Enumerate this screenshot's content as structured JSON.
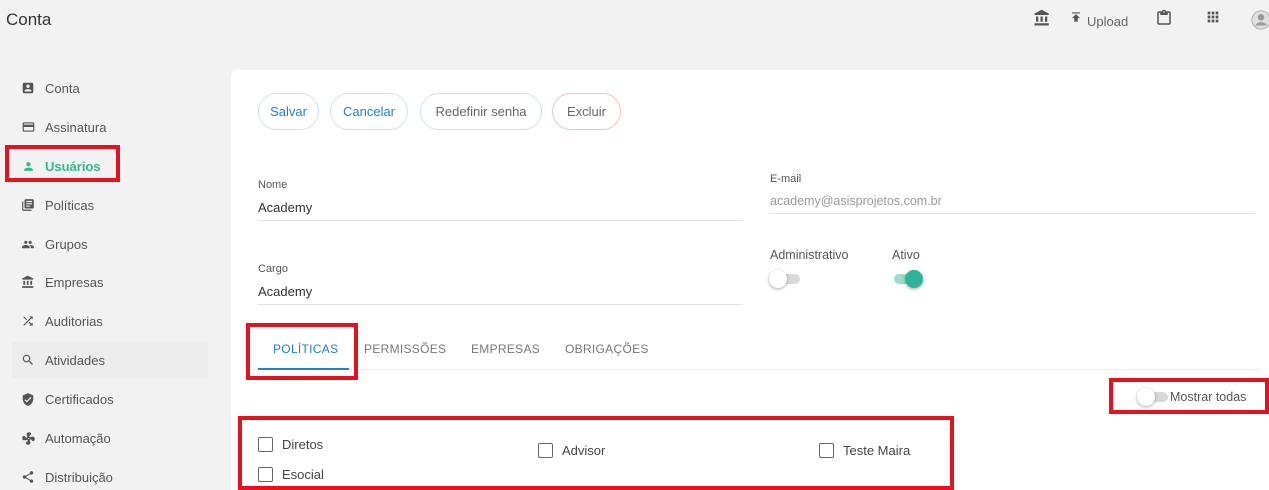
{
  "app": {
    "title": "Conta"
  },
  "topbar": {
    "upload_label": "Upload",
    "icons": [
      "bank-icon",
      "upload-icon",
      "clipboard-icon",
      "apps-grid-icon",
      "account-circle-icon"
    ]
  },
  "sidebar": {
    "items": [
      {
        "label": "Conta",
        "icon": "account-box-icon"
      },
      {
        "label": "Assinatura",
        "icon": "credit-card-icon"
      },
      {
        "label": "Usuários",
        "icon": "person-icon"
      },
      {
        "label": "Políticas",
        "icon": "library-books-icon"
      },
      {
        "label": "Grupos",
        "icon": "people-icon"
      },
      {
        "label": "Empresas",
        "icon": "bank-icon"
      },
      {
        "label": "Auditorias",
        "icon": "shuffle-icon"
      },
      {
        "label": "Atividades",
        "icon": "search-icon"
      },
      {
        "label": "Certificados",
        "icon": "shield-check-icon"
      },
      {
        "label": "Automação",
        "icon": "fan-icon"
      },
      {
        "label": "Distribuição",
        "icon": "share-icon"
      }
    ],
    "active": "Usuários"
  },
  "actions": {
    "save": "Salvar",
    "cancel": "Cancelar",
    "reset_password": "Redefinir senha",
    "delete": "Excluir"
  },
  "form": {
    "name_label": "Nome",
    "name_value": "Academy",
    "email_label": "E-mail",
    "email_value": "academy@asisprojetos.com.br",
    "role_label": "Cargo",
    "role_value": "Academy",
    "admin_label": "Administrativo",
    "admin_on": false,
    "active_label": "Ativo",
    "active_on": true
  },
  "tabs": {
    "items": [
      "POLÍTICAS",
      "PERMISSÕES",
      "EMPRESAS",
      "OBRIGAÇÕES"
    ],
    "active": "POLÍTICAS"
  },
  "policies": {
    "show_all_label": "Mostrar todas",
    "show_all_on": false,
    "items": [
      "Diretos",
      "Advisor",
      "Teste Maira",
      "Esocial"
    ]
  },
  "colors": {
    "accent": "#1e7fd0",
    "active_nav": "#2ebc8b",
    "toggle_on": "#2eb39b",
    "highlight": "#e0131f"
  }
}
